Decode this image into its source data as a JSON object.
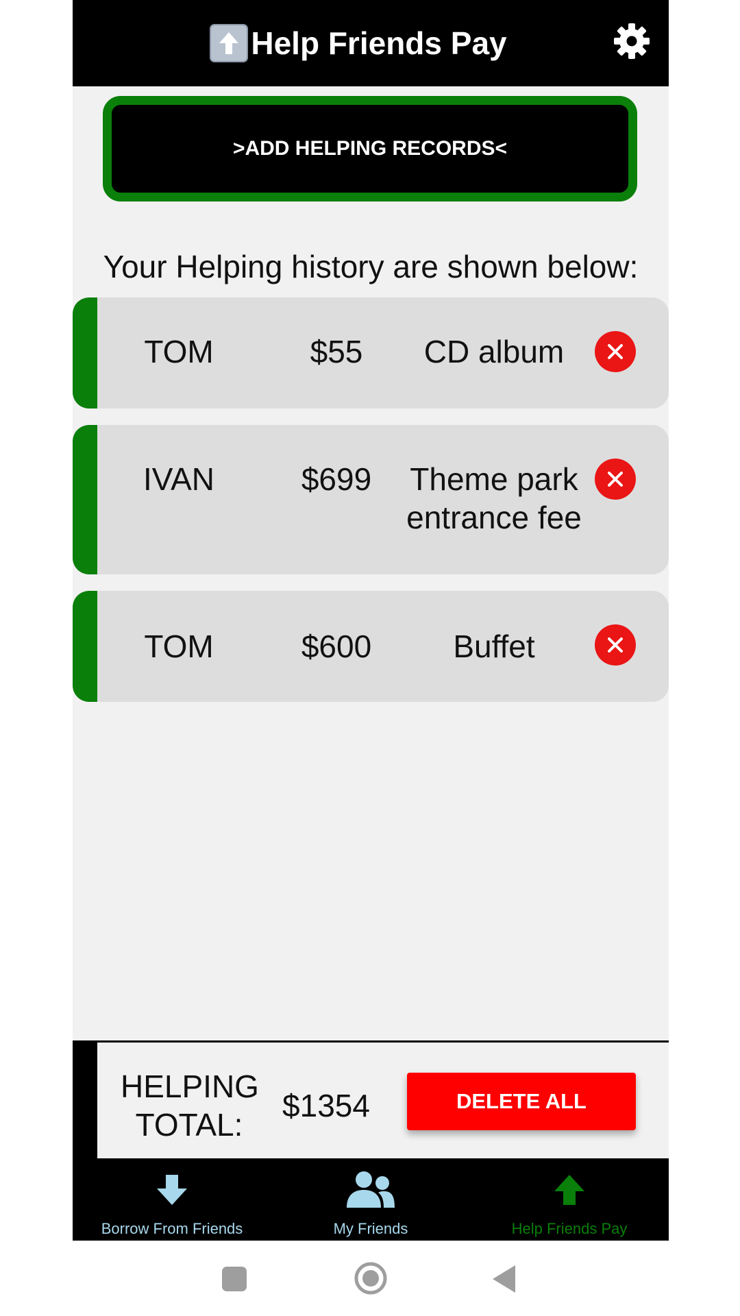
{
  "header": {
    "title": "Help Friends Pay",
    "settings_icon": "gear-icon"
  },
  "add_button": {
    "label": ">ADD HELPING RECORDS<"
  },
  "history_label": "Your Helping history are shown below:",
  "records": [
    {
      "name": "TOM",
      "amount": "$55",
      "description": "CD album"
    },
    {
      "name": "IVAN",
      "amount": "$699",
      "description": "Theme park entrance fee"
    },
    {
      "name": "TOM",
      "amount": "$600",
      "description": "Buffet"
    }
  ],
  "summary": {
    "label": "HELPING TOTAL:",
    "total": "$1354",
    "delete_all_label": "DELETE ALL"
  },
  "bottom_nav": [
    {
      "label": "Borrow From Friends",
      "icon": "arrow-down-icon",
      "active": false
    },
    {
      "label": "My Friends",
      "icon": "people-icon",
      "active": false
    },
    {
      "label": "Help Friends Pay",
      "icon": "arrow-up-icon",
      "active": true
    }
  ],
  "colors": {
    "accent_green": "#0a7f0a",
    "danger_red": "#ff0000",
    "nav_inactive": "#a8d8ec",
    "nav_active": "#0a7f0a",
    "background": "#f1f1f1"
  }
}
